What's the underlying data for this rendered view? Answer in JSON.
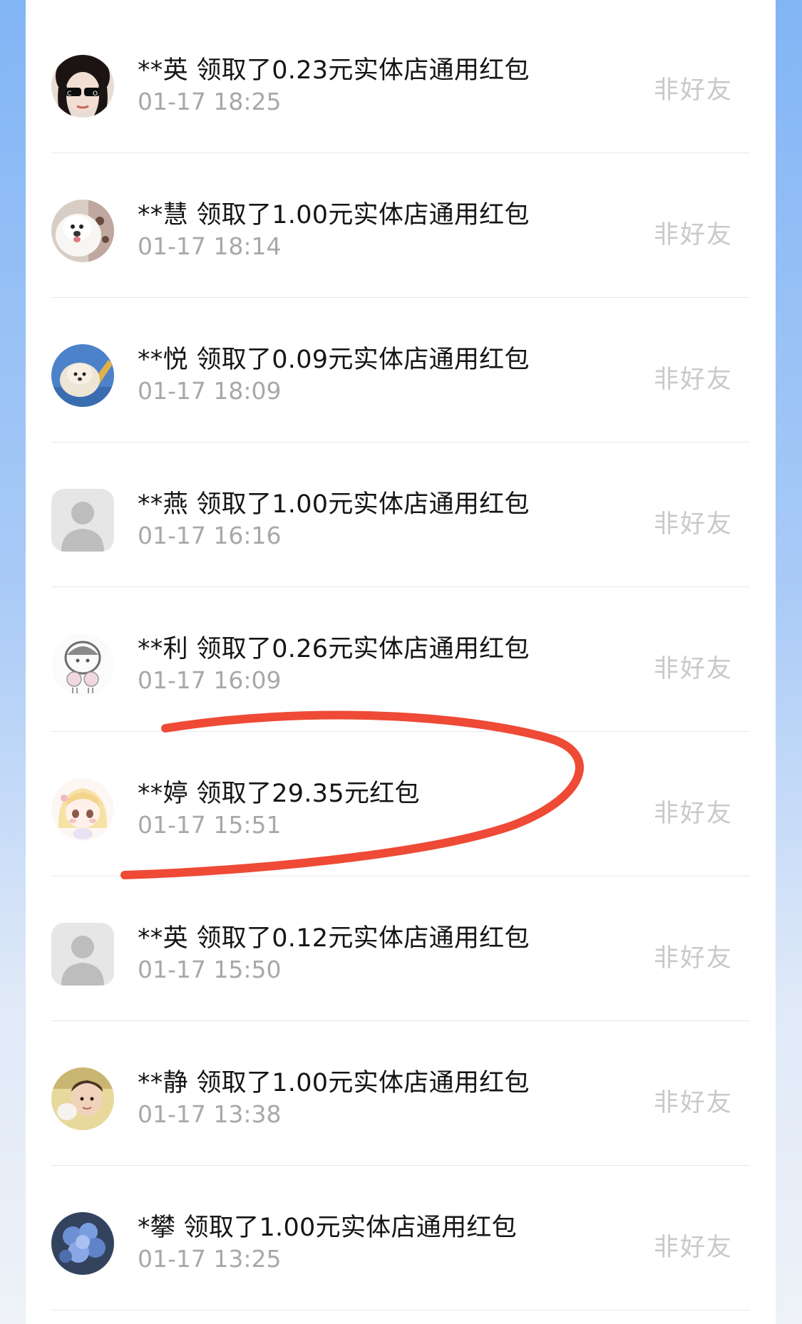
{
  "records": [
    {
      "name": "**英",
      "action": "领取了0.23元实体店通用红包",
      "time": "01-17 18:25",
      "status": "非好友",
      "avatar": "sunglasses-avatar"
    },
    {
      "name": "**慧",
      "action": "领取了1.00元实体店通用红包",
      "time": "01-17 18:14",
      "status": "非好友",
      "avatar": "white-dog-avatar"
    },
    {
      "name": "**悦",
      "action": "领取了0.09元实体店通用红包",
      "time": "01-17 18:09",
      "status": "非好友",
      "avatar": "fluffy-pet-avatar"
    },
    {
      "name": "**燕",
      "action": "领取了1.00元实体店通用红包",
      "time": "01-17 16:16",
      "status": "非好友",
      "avatar": "default-user-avatar"
    },
    {
      "name": "**利",
      "action": "领取了0.26元实体店通用红包",
      "time": "01-17 16:09",
      "status": "非好友",
      "avatar": "sketch-girl-avatar"
    },
    {
      "name": "**婷",
      "action": "领取了29.35元红包",
      "time": "01-17 15:51",
      "status": "非好友",
      "avatar": "anime-girl-avatar"
    },
    {
      "name": "**英",
      "action": "领取了0.12元实体店通用红包",
      "time": "01-17 15:50",
      "status": "非好友",
      "avatar": "default-user-avatar"
    },
    {
      "name": "**静",
      "action": "领取了1.00元实体店通用红包",
      "time": "01-17 13:38",
      "status": "非好友",
      "avatar": "child-photo-avatar"
    },
    {
      "name": "*攀",
      "action": "领取了1.00元实体店通用红包",
      "time": "01-17 13:25",
      "status": "非好友",
      "avatar": "flower-avatar"
    }
  ],
  "colors": {
    "highlight": "#ee4a36",
    "status": "#c9c9c9",
    "time": "#a8a8a8",
    "title": "#151515"
  }
}
